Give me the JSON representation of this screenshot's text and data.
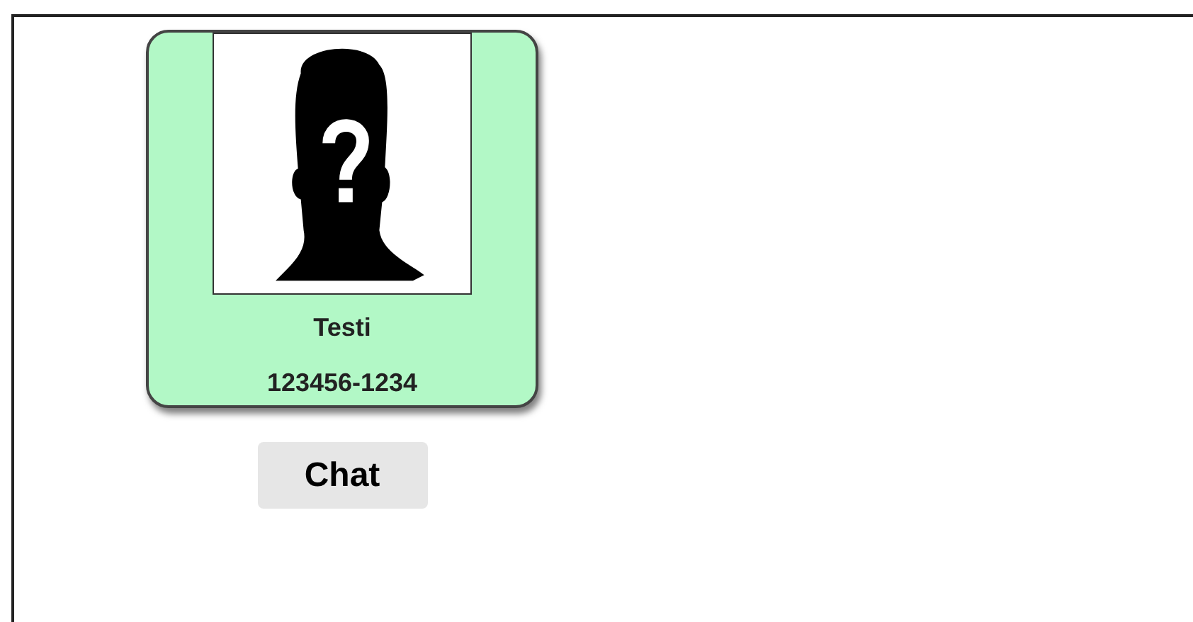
{
  "contact_card": {
    "name": "Testi",
    "phone": "123456-1234"
  },
  "chat_button": {
    "label": "Chat"
  }
}
